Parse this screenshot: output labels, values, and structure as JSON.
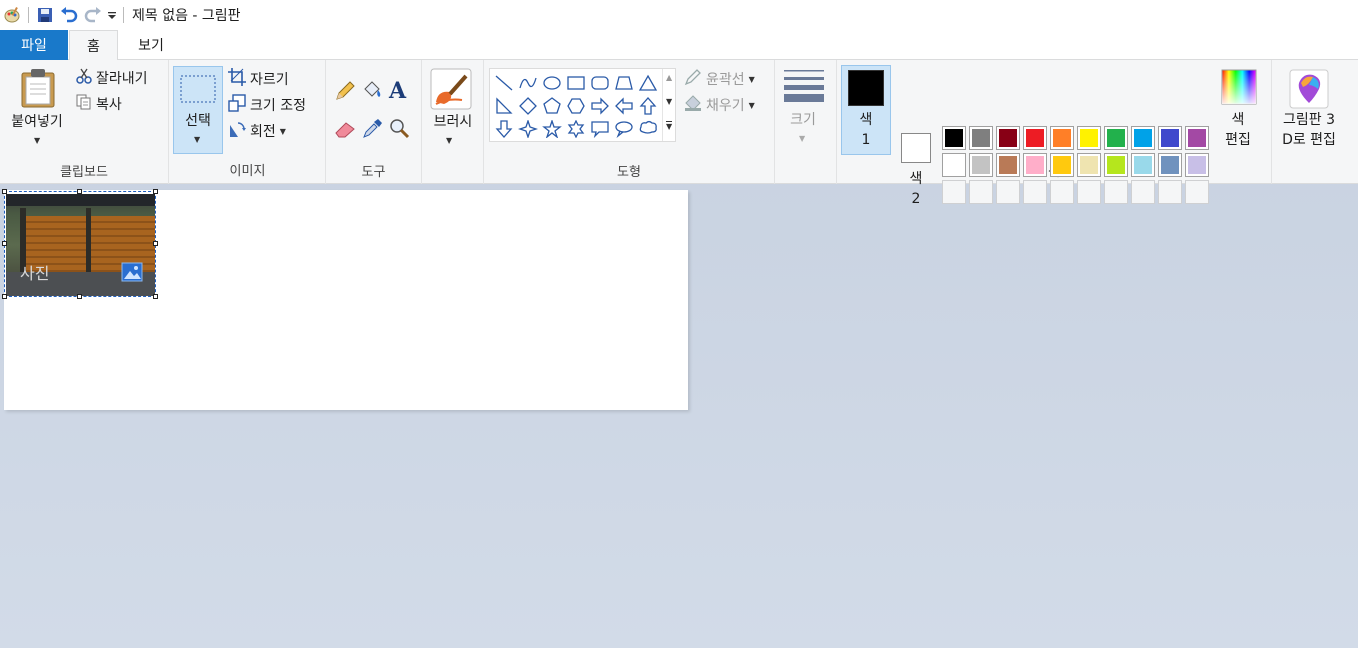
{
  "title": "제목 없음 - 그림판",
  "tabs": {
    "file": "파일",
    "home": "홈",
    "view": "보기"
  },
  "clipboard": {
    "paste": "붙여넣기",
    "cut": "잘라내기",
    "copy": "복사",
    "group": "클립보드"
  },
  "image": {
    "select": "선택",
    "crop": "자르기",
    "resize": "크기 조정",
    "rotate": "회전",
    "group": "이미지"
  },
  "tools": {
    "group": "도구"
  },
  "brushes": {
    "label": "브러시"
  },
  "shapes": {
    "outline": "윤곽선",
    "fill": "채우기",
    "group": "도형"
  },
  "size": {
    "label": "크기"
  },
  "colors": {
    "color1": "색",
    "color1_num": "1",
    "color2": "색",
    "color2_num": "2",
    "edit_line1": "색",
    "edit_line2": "편집",
    "group": "색",
    "color1_value": "#000000",
    "color2_value": "#ffffff",
    "palette_row1": [
      "#000000",
      "#7f7f7f",
      "#880015",
      "#ed1c24",
      "#ff7f27",
      "#fff200",
      "#22b14c",
      "#00a2e8",
      "#3f48cc",
      "#a349a4"
    ],
    "palette_row2": [
      "#ffffff",
      "#c3c3c3",
      "#b97a57",
      "#ffaec9",
      "#ffc90e",
      "#efe4b0",
      "#b5e61d",
      "#99d9ea",
      "#7092be",
      "#c8bfe7"
    ]
  },
  "paint3d": {
    "line1": "그림판 3",
    "line2": "D로 편집"
  },
  "canvas": {
    "picture_label": "사진"
  }
}
